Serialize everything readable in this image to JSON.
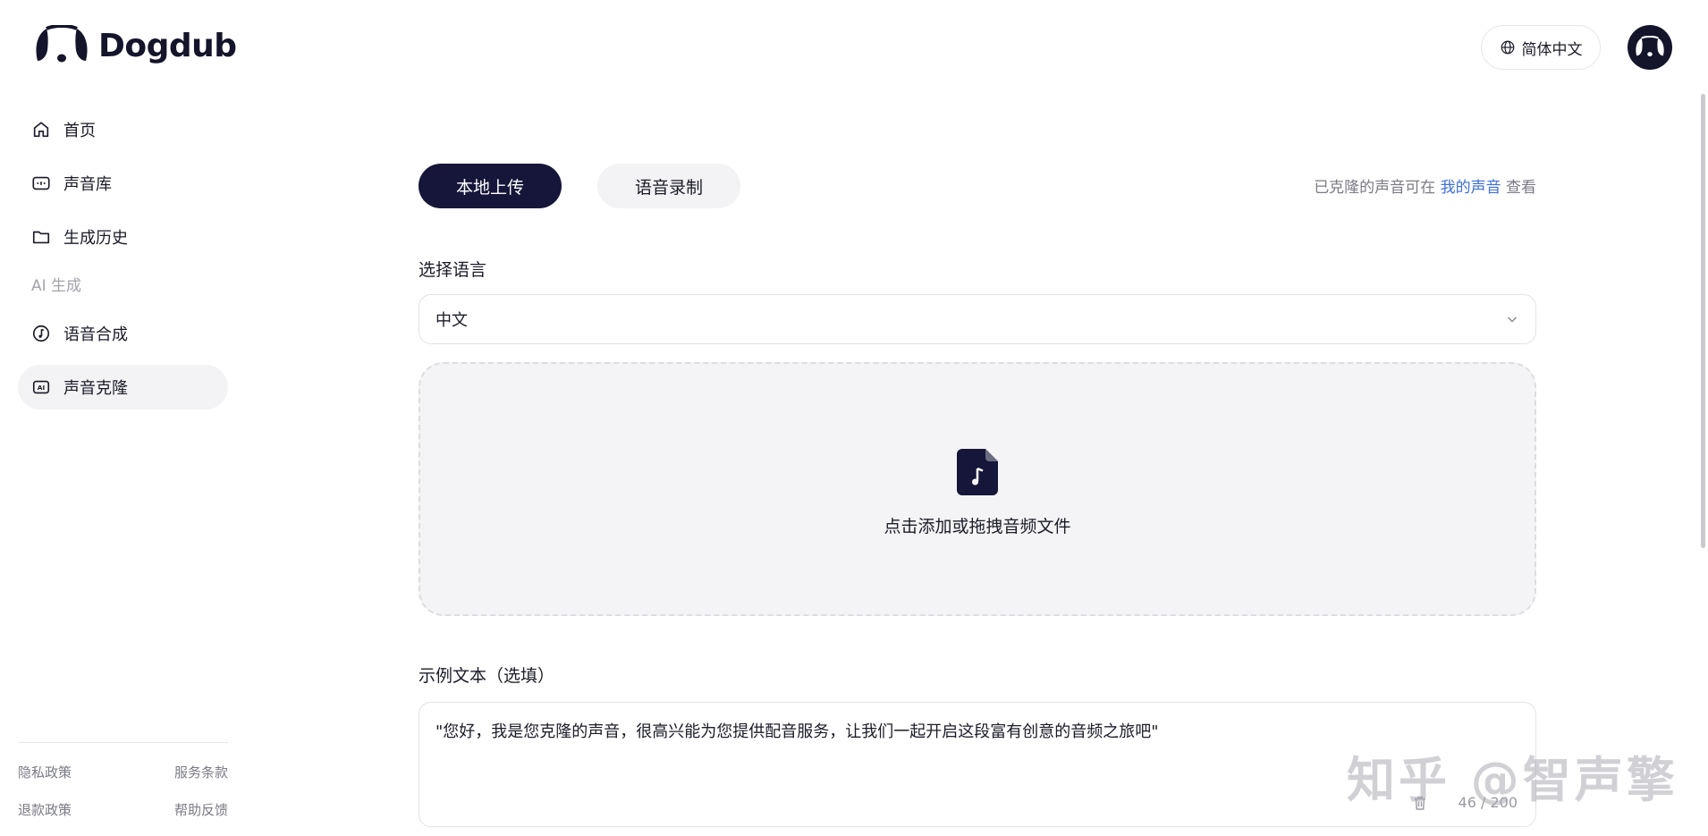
{
  "app": {
    "name": "Dogdub"
  },
  "sidebar": {
    "items": [
      {
        "label": "首页",
        "icon": "home-icon"
      },
      {
        "label": "声音库",
        "icon": "voice-library-icon"
      },
      {
        "label": "生成历史",
        "icon": "folder-icon"
      }
    ],
    "section_label": "AI 生成",
    "ai_items": [
      {
        "label": "语音合成",
        "icon": "music-note-icon"
      },
      {
        "label": "声音克隆",
        "icon": "ai-icon",
        "active": true
      }
    ],
    "footer": {
      "privacy": "隐私政策",
      "terms": "服务条款",
      "refund": "退款政策",
      "feedback": "帮助反馈"
    }
  },
  "header": {
    "language": "简体中文"
  },
  "main": {
    "tabs": {
      "upload": "本地上传",
      "record": "语音录制"
    },
    "hint": {
      "prefix": "已克隆的声音可在 ",
      "link": "我的声音",
      "suffix": " 查看"
    },
    "language_label": "选择语言",
    "language_value": "中文",
    "dropzone_text": "点击添加或拖拽音频文件",
    "sample_label": "示例文本（选填）",
    "sample_text": "\"您好，我是您克隆的声音，很高兴能为您提供配音服务，让我们一起开启这段富有创意的音频之旅吧\"",
    "counter": "46 / 200"
  },
  "watermark": "知乎 @智声擎",
  "colors": {
    "primary": "#16163a",
    "link": "#3f6fd6",
    "active_bg": "#f3f3f5"
  }
}
